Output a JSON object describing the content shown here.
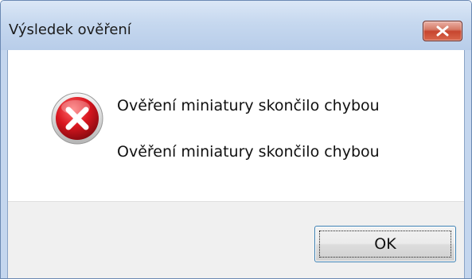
{
  "window": {
    "title": "Výsledek ověření"
  },
  "icons": {
    "close": "close-icon",
    "error": "error-icon"
  },
  "message": {
    "line1": "Ověření miniatury skončilo chybou",
    "line2": "Ověření miniatury skončilo chybou"
  },
  "buttons": {
    "ok_label": "OK"
  },
  "colors": {
    "title_bar": "#c6d8ef",
    "close_button": "#c7452f",
    "error_icon": "#c8102e",
    "footer_background": "#f0f0f0"
  }
}
